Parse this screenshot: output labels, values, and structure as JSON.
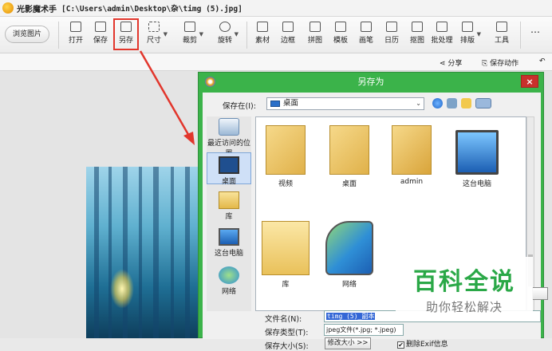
{
  "app": {
    "title": "光影魔术手",
    "path": "[C:\\Users\\admin\\Desktop\\杂\\timg (5).jpg]"
  },
  "toolbar": {
    "browse": "浏览图片",
    "buttons": [
      "打开",
      "保存",
      "另存",
      "尺寸",
      "裁剪",
      "旋转",
      "素材",
      "边框",
      "拼图",
      "模板",
      "画笔",
      "日历",
      "抠图",
      "批处理",
      "排版",
      "工具"
    ]
  },
  "subbar": {
    "share": "分享",
    "save_action": "保存动作"
  },
  "dialog": {
    "title": "另存为",
    "save_in_label": "保存在(I):",
    "save_in_value": "桌面",
    "places": [
      "最近访问的位置",
      "桌面",
      "库",
      "这台电脑",
      "网络"
    ],
    "files": [
      "视频",
      "桌面",
      "admin",
      "这台电脑",
      "库",
      "网络"
    ],
    "filename_label": "文件名(N):",
    "filename_value": "timg (5)_副本",
    "filetype_label": "保存类型(T):",
    "filetype_value": "jpeg文件(*.jpg; *.jpeg)",
    "size_label": "保存大小(S):",
    "size_button": "修改大小 >>",
    "exif_label": "删除Exif信息",
    "close": "×"
  },
  "watermark": {
    "line1": "百科全说",
    "line2": "助你轻松解决"
  }
}
